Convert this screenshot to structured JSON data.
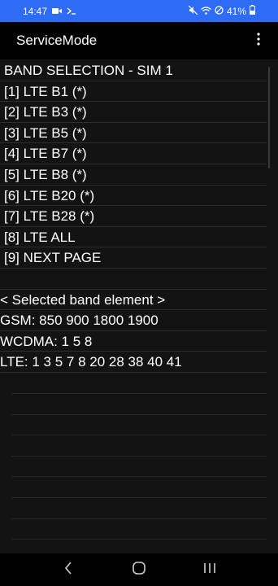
{
  "status_bar": {
    "time": "14:47",
    "battery": "41%"
  },
  "app_bar": {
    "title": "ServiceMode"
  },
  "band_menu": [
    "BAND SELECTION - SIM 1",
    "[1] LTE B1 (*)",
    "[2] LTE B3 (*)",
    "[3] LTE B5 (*)",
    "[4] LTE B7 (*)",
    "[5] LTE B8 (*)",
    "[6] LTE B20 (*)",
    "[7] LTE B28 (*)",
    "[8] LTE ALL",
    "[9] NEXT PAGE"
  ],
  "selected_band_info": [
    "",
    "< Selected band element >",
    "GSM: 850 900 1800 1900",
    "WCDMA: 1 5 8",
    "LTE: 1 3 5 7 8 20 28 38 40 41"
  ]
}
